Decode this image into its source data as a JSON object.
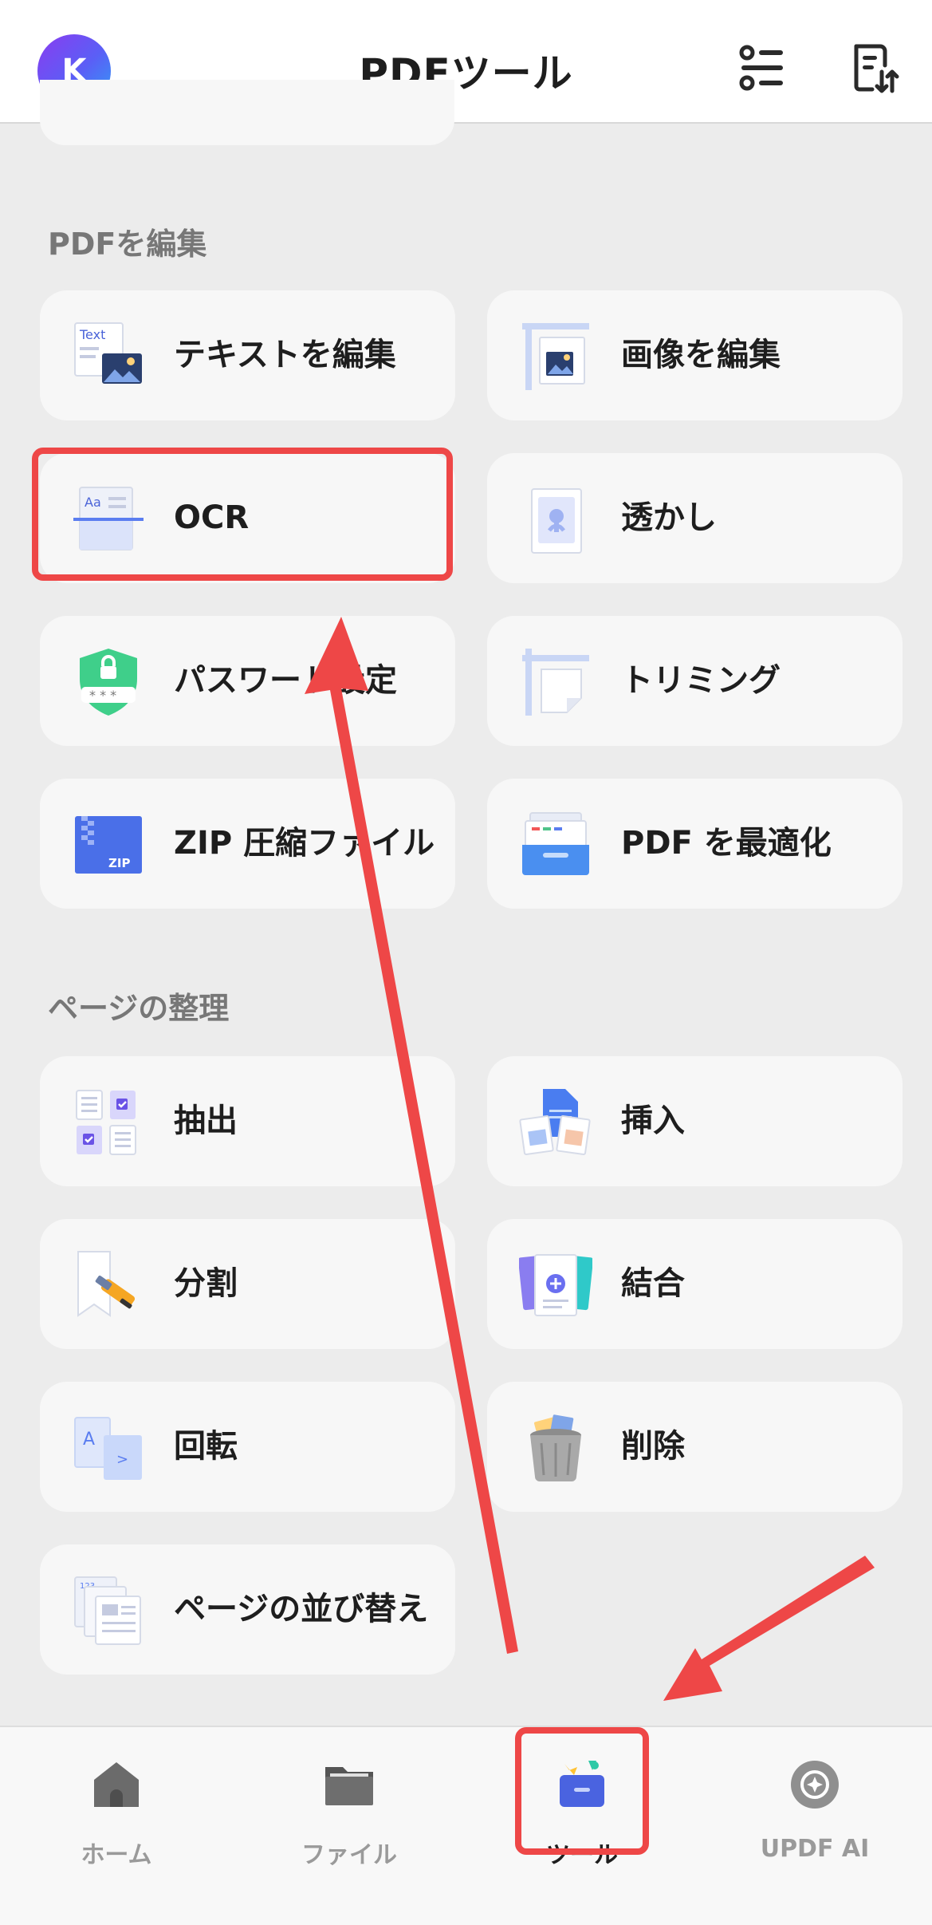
{
  "header": {
    "avatar_initial": "K",
    "title": "PDFツール",
    "list_icon": "list-icon",
    "sort_icon": "document-sort-icon"
  },
  "sections": {
    "edit": {
      "title": "PDFを編集",
      "items": [
        {
          "label": "テキストを編集",
          "icon": "edit-text-icon"
        },
        {
          "label": "画像を編集",
          "icon": "edit-image-icon"
        },
        {
          "label": "OCR",
          "icon": "ocr-icon"
        },
        {
          "label": "透かし",
          "icon": "watermark-icon"
        },
        {
          "label": "パスワード設定",
          "icon": "password-icon"
        },
        {
          "label": "トリミング",
          "icon": "crop-icon"
        },
        {
          "label": "ZIP 圧縮ファイル",
          "icon": "zip-icon"
        },
        {
          "label": "PDF を最適化",
          "icon": "optimize-icon"
        }
      ]
    },
    "organize": {
      "title": "ページの整理",
      "items": [
        {
          "label": "抽出",
          "icon": "extract-icon"
        },
        {
          "label": "挿入",
          "icon": "insert-icon"
        },
        {
          "label": "分割",
          "icon": "split-icon"
        },
        {
          "label": "結合",
          "icon": "merge-icon"
        },
        {
          "label": "回転",
          "icon": "rotate-icon"
        },
        {
          "label": "削除",
          "icon": "delete-icon"
        },
        {
          "label": "ページの並び替え",
          "icon": "reorder-icon"
        }
      ]
    }
  },
  "bottom_nav": {
    "items": [
      {
        "label": "ホーム",
        "icon": "home-icon"
      },
      {
        "label": "ファイル",
        "icon": "folder-icon"
      },
      {
        "label": "ツール",
        "icon": "tools-icon",
        "active": true
      },
      {
        "label": "UPDF AI",
        "icon": "ai-icon"
      }
    ]
  },
  "colors": {
    "accent_red": "#ee4747",
    "card_bg": "#f7f7f7",
    "page_bg": "#ececec"
  }
}
